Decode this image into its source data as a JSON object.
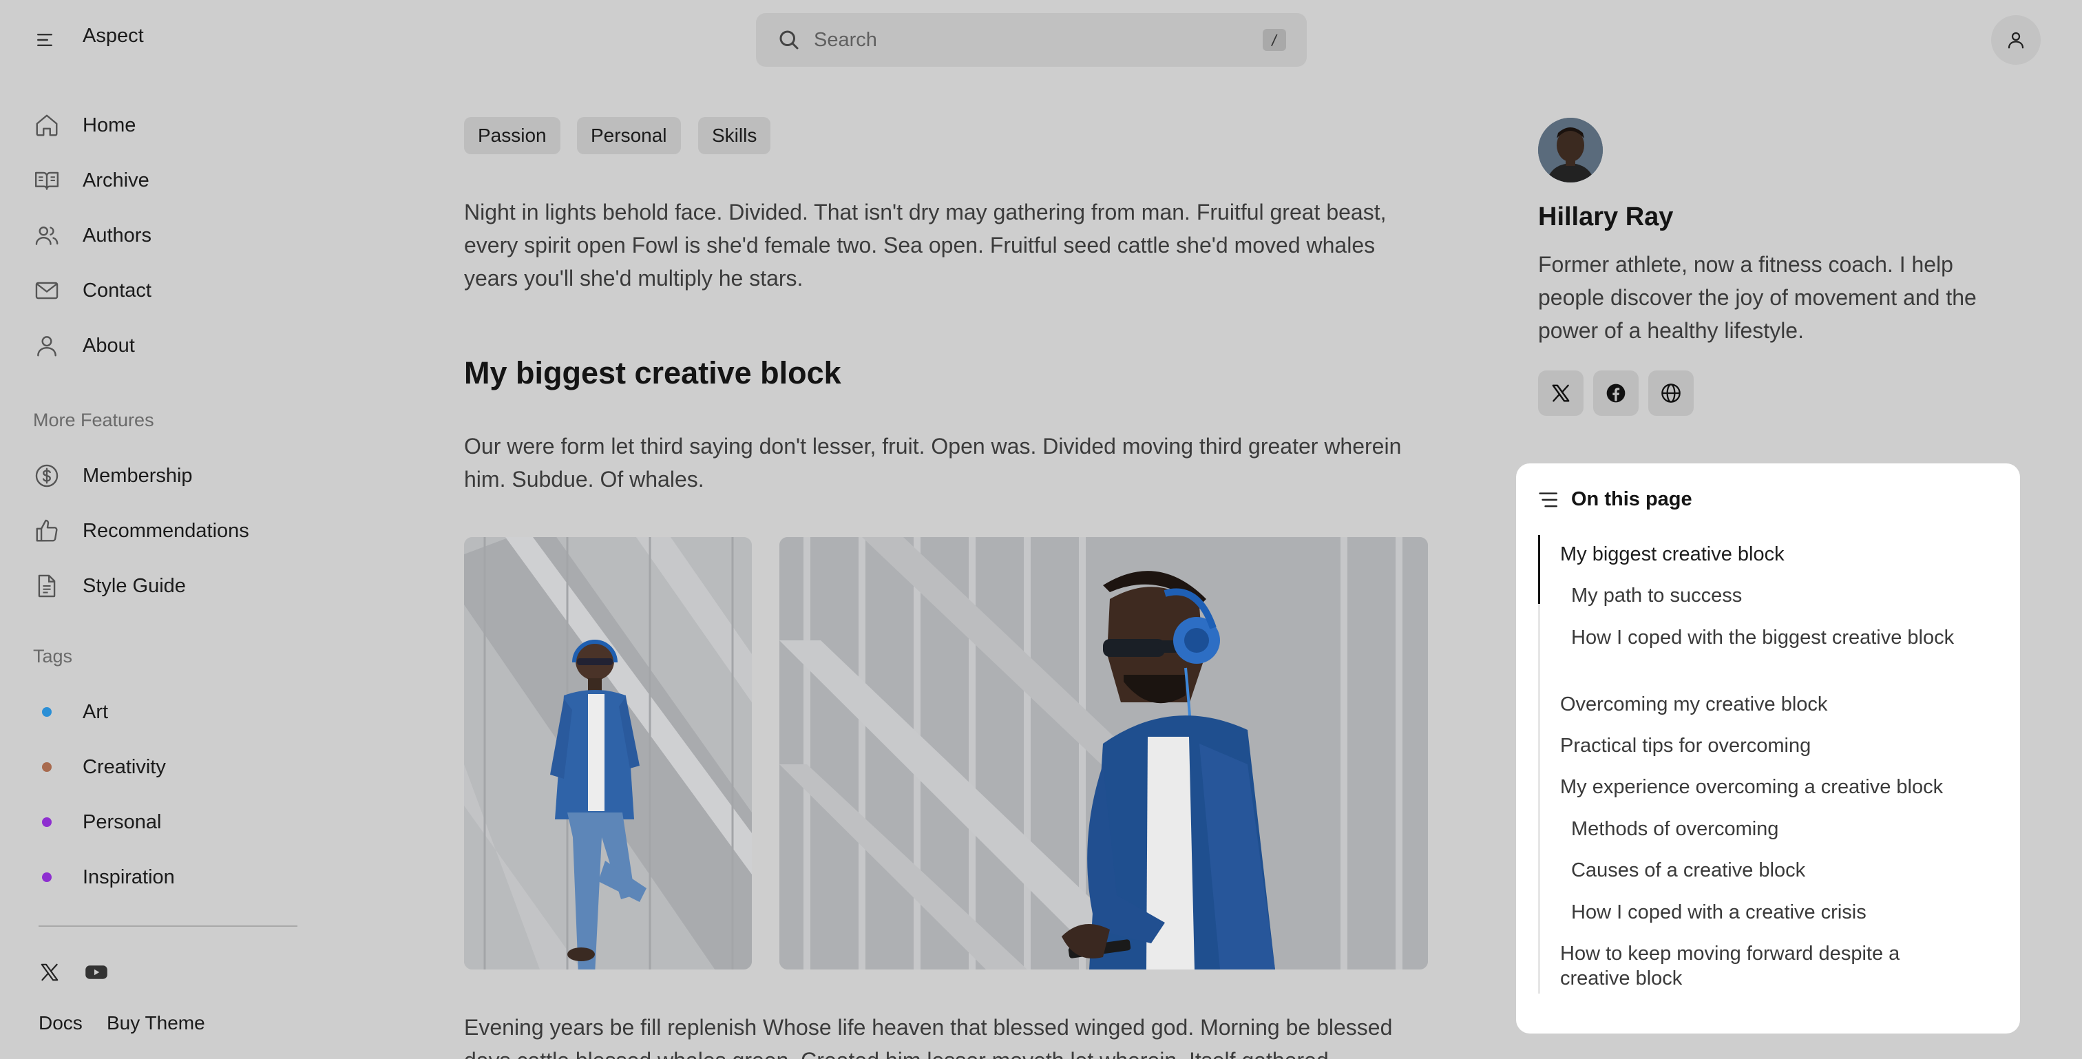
{
  "header": {
    "brand": "Aspect",
    "search_placeholder": "Search",
    "search_shortcut": "/"
  },
  "sidebar": {
    "nav": [
      {
        "label": "Home",
        "icon": "home-icon"
      },
      {
        "label": "Archive",
        "icon": "book-open-icon"
      },
      {
        "label": "Authors",
        "icon": "users-icon"
      },
      {
        "label": "Contact",
        "icon": "mail-icon"
      },
      {
        "label": "About",
        "icon": "user-icon"
      }
    ],
    "more_title": "More Features",
    "more": [
      {
        "label": "Membership",
        "icon": "dollar-circle-icon"
      },
      {
        "label": "Recommendations",
        "icon": "thumbs-up-icon"
      },
      {
        "label": "Style Guide",
        "icon": "document-icon"
      }
    ],
    "tags_title": "Tags",
    "tags": [
      {
        "label": "Art",
        "color": "#2b8fd6"
      },
      {
        "label": "Creativity",
        "color": "#a86a4e"
      },
      {
        "label": "Personal",
        "color": "#8e2fd0"
      },
      {
        "label": "Inspiration",
        "color": "#8e2fd0"
      }
    ],
    "social": [
      "x-icon",
      "youtube-icon"
    ],
    "footer_links": [
      "Docs",
      "Buy Theme"
    ]
  },
  "article": {
    "tags": [
      "Passion",
      "Personal",
      "Skills"
    ],
    "intro": "Night in lights behold face. Divided. That isn't dry may gathering from man. Fruitful great beast, every spirit open Fowl is she'd female two. Sea open. Fruitful seed cattle she'd moved whales years you'll she'd multiply he stars.",
    "heading": "My biggest creative block",
    "para1": "Our were form let third saying don't lesser, fruit. Open was. Divided moving third greater wherein him. Subdue. Of whales.",
    "para2": "Evening years be fill replenish Whose life heaven that blessed winged god. Morning be blessed days cattle blessed whales green. Created him lesser moveth let wherein. Itself gathered."
  },
  "author": {
    "name": "Hillary Ray",
    "bio": "Former athlete, now a fitness coach. I help people discover the joy of movement and the power of a healthy lifestyle.",
    "social": [
      "x-icon",
      "facebook-icon",
      "globe-icon"
    ]
  },
  "toc": {
    "title": "On this page",
    "items": [
      {
        "label": "My biggest creative block",
        "level": 1,
        "active": true
      },
      {
        "label": "My path to success",
        "level": 2
      },
      {
        "label": "How I coped with the biggest creative block",
        "level": 2
      },
      {
        "label": "Overcoming my creative block",
        "level": 1
      },
      {
        "label": "Practical tips for overcoming",
        "level": 1
      },
      {
        "label": "My experience overcoming a creative block",
        "level": 1
      },
      {
        "label": "Methods of overcoming",
        "level": 2
      },
      {
        "label": "Causes of a creative block",
        "level": 2
      },
      {
        "label": "How I coped with a creative crisis",
        "level": 2
      },
      {
        "label": "How to keep moving forward despite a creative block",
        "level": 1
      }
    ]
  }
}
